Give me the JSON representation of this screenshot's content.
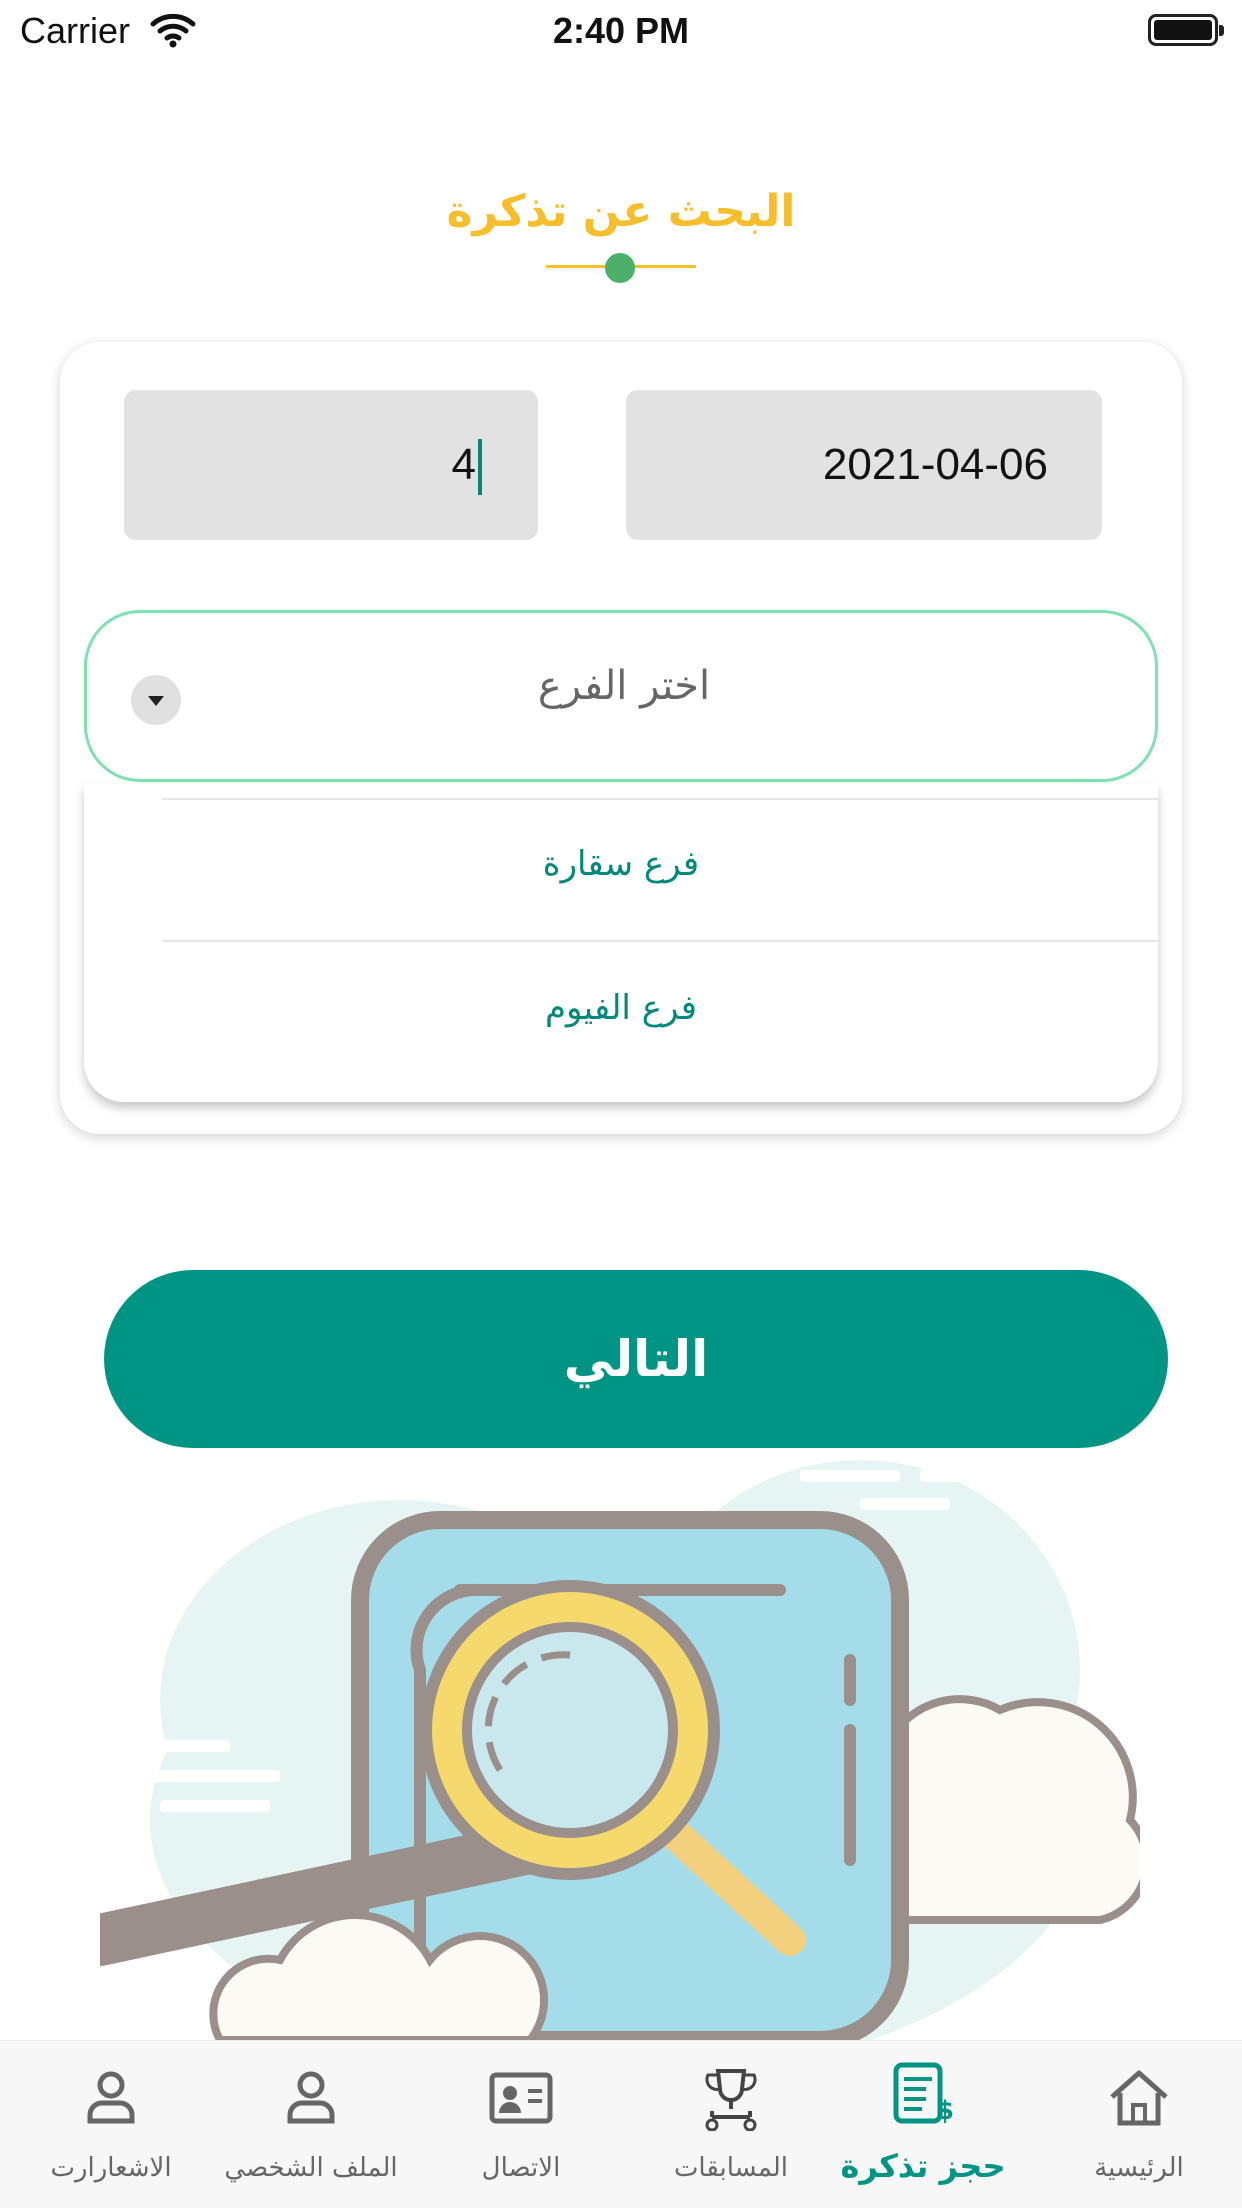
{
  "status_bar": {
    "carrier": "Carrier",
    "time": "2:40 PM"
  },
  "page": {
    "title": "البحث عن تذكرة"
  },
  "form": {
    "quantity_value": "4",
    "date_value": "2021-04-06",
    "branch_select": {
      "placeholder": "اختر الفرع",
      "options": [
        "فرع سقارة",
        "فرع الفيوم"
      ]
    }
  },
  "next_button": {
    "label": "التالي"
  },
  "bottom_nav": {
    "items": [
      {
        "label": "الاشعارارت",
        "icon": "person-icon"
      },
      {
        "label": "الملف الشخصي",
        "icon": "person-icon"
      },
      {
        "label": "الاتصال",
        "icon": "contact-card-icon"
      },
      {
        "label": "المسابقات",
        "icon": "trophy-icon"
      },
      {
        "label": "حجز تذكرة",
        "icon": "ticket-receipt-icon",
        "active": true
      },
      {
        "label": "الرئيسية",
        "icon": "home-icon"
      }
    ]
  },
  "colors": {
    "accent": "#009485",
    "title": "#f5be2a",
    "select_border": "#7fe0b1",
    "dot": "#4caf6a"
  }
}
